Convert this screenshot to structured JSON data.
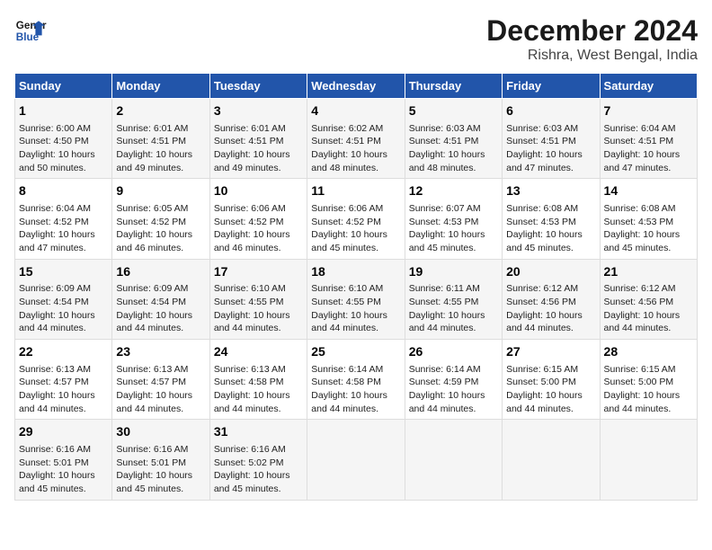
{
  "header": {
    "logo_line1": "General",
    "logo_line2": "Blue",
    "title": "December 2024",
    "subtitle": "Rishra, West Bengal, India"
  },
  "days_header": [
    "Sunday",
    "Monday",
    "Tuesday",
    "Wednesday",
    "Thursday",
    "Friday",
    "Saturday"
  ],
  "weeks": [
    [
      {
        "day": "1",
        "lines": [
          "Sunrise: 6:00 AM",
          "Sunset: 4:50 PM",
          "Daylight: 10 hours",
          "and 50 minutes."
        ]
      },
      {
        "day": "2",
        "lines": [
          "Sunrise: 6:01 AM",
          "Sunset: 4:51 PM",
          "Daylight: 10 hours",
          "and 49 minutes."
        ]
      },
      {
        "day": "3",
        "lines": [
          "Sunrise: 6:01 AM",
          "Sunset: 4:51 PM",
          "Daylight: 10 hours",
          "and 49 minutes."
        ]
      },
      {
        "day": "4",
        "lines": [
          "Sunrise: 6:02 AM",
          "Sunset: 4:51 PM",
          "Daylight: 10 hours",
          "and 48 minutes."
        ]
      },
      {
        "day": "5",
        "lines": [
          "Sunrise: 6:03 AM",
          "Sunset: 4:51 PM",
          "Daylight: 10 hours",
          "and 48 minutes."
        ]
      },
      {
        "day": "6",
        "lines": [
          "Sunrise: 6:03 AM",
          "Sunset: 4:51 PM",
          "Daylight: 10 hours",
          "and 47 minutes."
        ]
      },
      {
        "day": "7",
        "lines": [
          "Sunrise: 6:04 AM",
          "Sunset: 4:51 PM",
          "Daylight: 10 hours",
          "and 47 minutes."
        ]
      }
    ],
    [
      {
        "day": "8",
        "lines": [
          "Sunrise: 6:04 AM",
          "Sunset: 4:52 PM",
          "Daylight: 10 hours",
          "and 47 minutes."
        ]
      },
      {
        "day": "9",
        "lines": [
          "Sunrise: 6:05 AM",
          "Sunset: 4:52 PM",
          "Daylight: 10 hours",
          "and 46 minutes."
        ]
      },
      {
        "day": "10",
        "lines": [
          "Sunrise: 6:06 AM",
          "Sunset: 4:52 PM",
          "Daylight: 10 hours",
          "and 46 minutes."
        ]
      },
      {
        "day": "11",
        "lines": [
          "Sunrise: 6:06 AM",
          "Sunset: 4:52 PM",
          "Daylight: 10 hours",
          "and 45 minutes."
        ]
      },
      {
        "day": "12",
        "lines": [
          "Sunrise: 6:07 AM",
          "Sunset: 4:53 PM",
          "Daylight: 10 hours",
          "and 45 minutes."
        ]
      },
      {
        "day": "13",
        "lines": [
          "Sunrise: 6:08 AM",
          "Sunset: 4:53 PM",
          "Daylight: 10 hours",
          "and 45 minutes."
        ]
      },
      {
        "day": "14",
        "lines": [
          "Sunrise: 6:08 AM",
          "Sunset: 4:53 PM",
          "Daylight: 10 hours",
          "and 45 minutes."
        ]
      }
    ],
    [
      {
        "day": "15",
        "lines": [
          "Sunrise: 6:09 AM",
          "Sunset: 4:54 PM",
          "Daylight: 10 hours",
          "and 44 minutes."
        ]
      },
      {
        "day": "16",
        "lines": [
          "Sunrise: 6:09 AM",
          "Sunset: 4:54 PM",
          "Daylight: 10 hours",
          "and 44 minutes."
        ]
      },
      {
        "day": "17",
        "lines": [
          "Sunrise: 6:10 AM",
          "Sunset: 4:55 PM",
          "Daylight: 10 hours",
          "and 44 minutes."
        ]
      },
      {
        "day": "18",
        "lines": [
          "Sunrise: 6:10 AM",
          "Sunset: 4:55 PM",
          "Daylight: 10 hours",
          "and 44 minutes."
        ]
      },
      {
        "day": "19",
        "lines": [
          "Sunrise: 6:11 AM",
          "Sunset: 4:55 PM",
          "Daylight: 10 hours",
          "and 44 minutes."
        ]
      },
      {
        "day": "20",
        "lines": [
          "Sunrise: 6:12 AM",
          "Sunset: 4:56 PM",
          "Daylight: 10 hours",
          "and 44 minutes."
        ]
      },
      {
        "day": "21",
        "lines": [
          "Sunrise: 6:12 AM",
          "Sunset: 4:56 PM",
          "Daylight: 10 hours",
          "and 44 minutes."
        ]
      }
    ],
    [
      {
        "day": "22",
        "lines": [
          "Sunrise: 6:13 AM",
          "Sunset: 4:57 PM",
          "Daylight: 10 hours",
          "and 44 minutes."
        ]
      },
      {
        "day": "23",
        "lines": [
          "Sunrise: 6:13 AM",
          "Sunset: 4:57 PM",
          "Daylight: 10 hours",
          "and 44 minutes."
        ]
      },
      {
        "day": "24",
        "lines": [
          "Sunrise: 6:13 AM",
          "Sunset: 4:58 PM",
          "Daylight: 10 hours",
          "and 44 minutes."
        ]
      },
      {
        "day": "25",
        "lines": [
          "Sunrise: 6:14 AM",
          "Sunset: 4:58 PM",
          "Daylight: 10 hours",
          "and 44 minutes."
        ]
      },
      {
        "day": "26",
        "lines": [
          "Sunrise: 6:14 AM",
          "Sunset: 4:59 PM",
          "Daylight: 10 hours",
          "and 44 minutes."
        ]
      },
      {
        "day": "27",
        "lines": [
          "Sunrise: 6:15 AM",
          "Sunset: 5:00 PM",
          "Daylight: 10 hours",
          "and 44 minutes."
        ]
      },
      {
        "day": "28",
        "lines": [
          "Sunrise: 6:15 AM",
          "Sunset: 5:00 PM",
          "Daylight: 10 hours",
          "and 44 minutes."
        ]
      }
    ],
    [
      {
        "day": "29",
        "lines": [
          "Sunrise: 6:16 AM",
          "Sunset: 5:01 PM",
          "Daylight: 10 hours",
          "and 45 minutes."
        ]
      },
      {
        "day": "30",
        "lines": [
          "Sunrise: 6:16 AM",
          "Sunset: 5:01 PM",
          "Daylight: 10 hours",
          "and 45 minutes."
        ]
      },
      {
        "day": "31",
        "lines": [
          "Sunrise: 6:16 AM",
          "Sunset: 5:02 PM",
          "Daylight: 10 hours",
          "and 45 minutes."
        ]
      },
      {
        "day": "",
        "lines": []
      },
      {
        "day": "",
        "lines": []
      },
      {
        "day": "",
        "lines": []
      },
      {
        "day": "",
        "lines": []
      }
    ]
  ]
}
